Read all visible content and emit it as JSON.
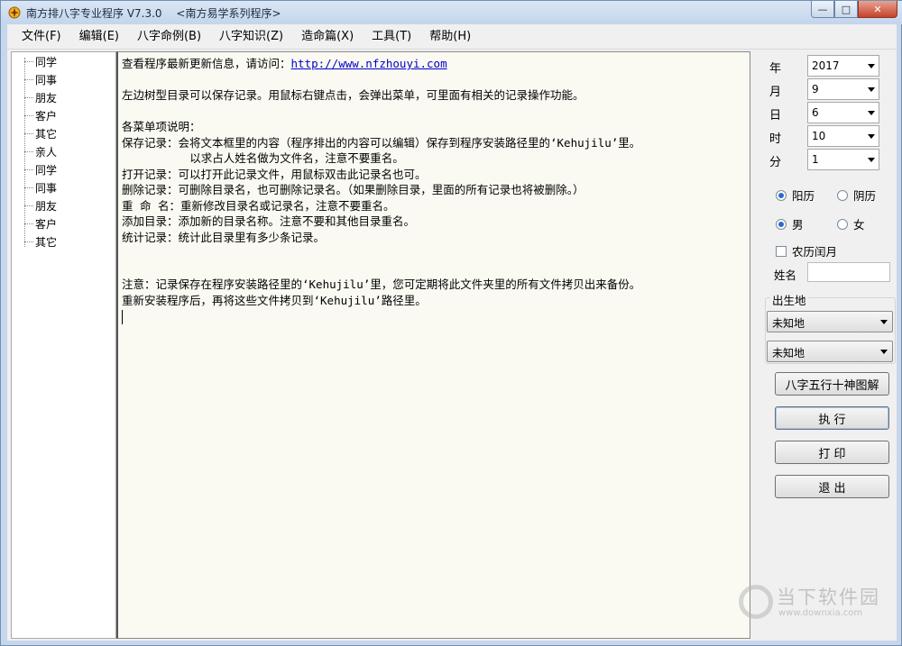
{
  "window": {
    "title": "南方排八字专业程序 V7.3.0",
    "subtitle": "<南方易学系列程序>",
    "minimize": "—",
    "maximize": "□",
    "close": "✕"
  },
  "menu": [
    "文件(F)",
    "编辑(E)",
    "八字命例(B)",
    "八字知识(Z)",
    "造命篇(X)",
    "工具(T)",
    "帮助(H)"
  ],
  "tree": [
    "同学",
    "同事",
    "朋友",
    "客户",
    "其它",
    "亲人",
    "同学",
    "同事",
    "朋友",
    "客户",
    "其它"
  ],
  "editor": {
    "line1_text": "查看程序最新更新信息，请访问：",
    "line1_link": "http://www.nfzhouyi.com",
    "lines": [
      "",
      "左边树型目录可以保存记录。用鼠标右键点击，会弹出菜单，可里面有相关的记录操作功能。",
      "",
      "各菜单项说明：",
      "保存记录：会将文本框里的内容（程序排出的内容可以编辑）保存到程序安装路径里的‘Kehujilu’里。",
      "          以求占人姓名做为文件名，注意不要重名。",
      "打开记录：可以打开此记录文件，用鼠标双击此记录名也可。",
      "删除记录：可删除目录名，也可删除记录名。（如果删除目录，里面的所有记录也将被删除。）",
      "重 命 名：重新修改目录名或记录名，注意不要重名。",
      "添加目录：添加新的目录名称。注意不要和其他目录重名。",
      "统计记录：统计此目录里有多少条记录。",
      "",
      "",
      "注意：记录保存在程序安装路径里的‘Kehujilu’里，您可定期将此文件夹里的所有文件拷贝出来备份。",
      "重新安装程序后，再将这些文件拷贝到‘Kehujilu’路径里。"
    ]
  },
  "panel": {
    "fields": [
      {
        "label": "年",
        "value": "2017"
      },
      {
        "label": "月",
        "value": "9"
      },
      {
        "label": "日",
        "value": "6"
      },
      {
        "label": "时",
        "value": "10"
      },
      {
        "label": "分",
        "value": "1"
      }
    ],
    "calendar": {
      "solar": "阳历",
      "lunar": "阴历",
      "selected": "solar"
    },
    "gender": {
      "male": "男",
      "female": "女",
      "selected": "male"
    },
    "leap_month": "农历闰月",
    "name_label": "姓名",
    "name_value": "",
    "birthplace_label": "出生地",
    "place1": "未知地",
    "place2": "未知地",
    "buttons": [
      "八字五行十神图解",
      "执 行",
      "打 印",
      "退 出"
    ]
  },
  "watermark": {
    "text": "当下软件园",
    "url": "www.downxia.com"
  }
}
